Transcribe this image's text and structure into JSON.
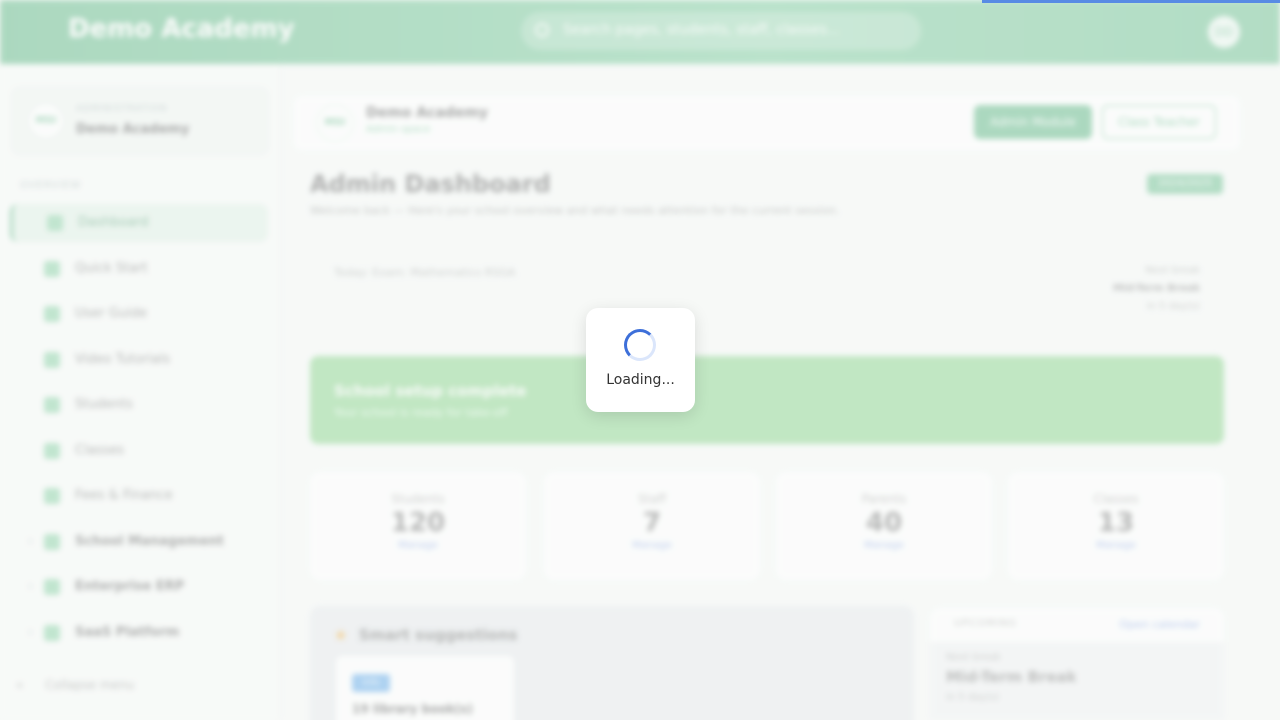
{
  "topbar": {
    "brand": "Demo Academy",
    "search_placeholder": "Search pages, students, staff, classes...",
    "avatar": "DD"
  },
  "sidebar": {
    "school_kicker": "ADMINISTRATION",
    "school_name": "Demo Academy",
    "logo": "MSI",
    "section_label": "OVERVIEW",
    "items": [
      {
        "label": "Dashboard",
        "icon": "home-icon"
      },
      {
        "label": "Quick Start",
        "icon": "rocket-icon"
      },
      {
        "label": "User Guide",
        "icon": "book-icon"
      },
      {
        "label": "Video Tutorials",
        "icon": "play-icon"
      },
      {
        "label": "Students",
        "icon": "student-icon"
      },
      {
        "label": "Classes",
        "icon": "monitor-icon"
      },
      {
        "label": "Fees & Finance",
        "icon": "wallet-icon"
      },
      {
        "label": "School Management",
        "icon": "building-icon"
      },
      {
        "label": "Enterprise ERP",
        "icon": "grid-icon"
      },
      {
        "label": "SaaS Platform",
        "icon": "cloud-icon"
      }
    ],
    "collapse_label": "Collapse menu"
  },
  "header_card": {
    "logo": "MSI",
    "name": "Demo Academy",
    "subtitle": "Admin space",
    "admin_button": "Admin Module",
    "teacher_button": "Class Teacher"
  },
  "dashboard": {
    "title": "Admin Dashboard",
    "subtitle": "Welcome back — Here's your school overview and what needs attention for the current session.",
    "year_badge": "2024/2025",
    "today": "Today: Exam: Mathematics RSGA",
    "next_break_label": "Next break",
    "next_break_title": "Mid-Term Break",
    "next_break_when": "in 5 day(s)"
  },
  "setup": {
    "title": "School setup complete",
    "subtitle": "Your school is ready for take-off"
  },
  "stats": [
    {
      "label": "Students",
      "value": "120",
      "link": "Manage"
    },
    {
      "label": "Staff",
      "value": "7",
      "link": "Manage"
    },
    {
      "label": "Parents",
      "value": "40",
      "link": "Manage"
    },
    {
      "label": "Classes",
      "value": "13",
      "link": "Manage"
    }
  ],
  "suggestions": {
    "title": "Smart suggestions",
    "badge": "Info",
    "card_text": "19 library book(s)"
  },
  "upcoming": {
    "label": "UPCOMING",
    "link": "Open calendar",
    "kicker": "Next break",
    "title": "Mid-Term Break",
    "when": "in 5 day(s)"
  },
  "loading": {
    "text": "Loading..."
  },
  "colors": {
    "brand_green": "#4caf78",
    "progress_blue": "#2f6fde",
    "banner_green": "#7ccf7f"
  }
}
